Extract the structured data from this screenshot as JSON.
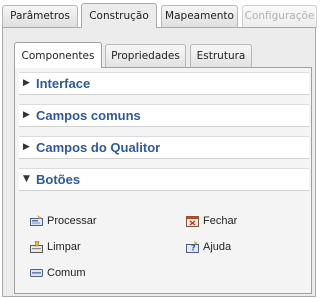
{
  "top_tabs": [
    {
      "label": "Parâmetros",
      "state": "normal"
    },
    {
      "label": "Construção",
      "state": "active"
    },
    {
      "label": "Mapeamento",
      "state": "normal"
    },
    {
      "label": "Configuraçõe",
      "state": "disabled"
    }
  ],
  "inner_tabs": [
    {
      "label": "Componentes",
      "state": "active"
    },
    {
      "label": "Propriedades",
      "state": "normal"
    },
    {
      "label": "Estrutura",
      "state": "normal"
    }
  ],
  "sections": [
    {
      "title": "Interface",
      "expanded": false
    },
    {
      "title": "Campos comuns",
      "expanded": false
    },
    {
      "title": "Campos do Qualitor",
      "expanded": false
    },
    {
      "title": "Botões",
      "expanded": true
    }
  ],
  "buttons_items": [
    {
      "label": "Processar",
      "icon": "process-icon"
    },
    {
      "label": "Fechar",
      "icon": "close-window-icon"
    },
    {
      "label": "Limpar",
      "icon": "clear-icon"
    },
    {
      "label": "Ajuda",
      "icon": "help-icon"
    },
    {
      "label": "Comum",
      "icon": "button-icon"
    }
  ],
  "colors": {
    "section_title": "#2f5a9a",
    "panel_bg": "#ececec",
    "inner_bg": "#f4f4f4",
    "disabled_text": "#b3b3b3"
  }
}
